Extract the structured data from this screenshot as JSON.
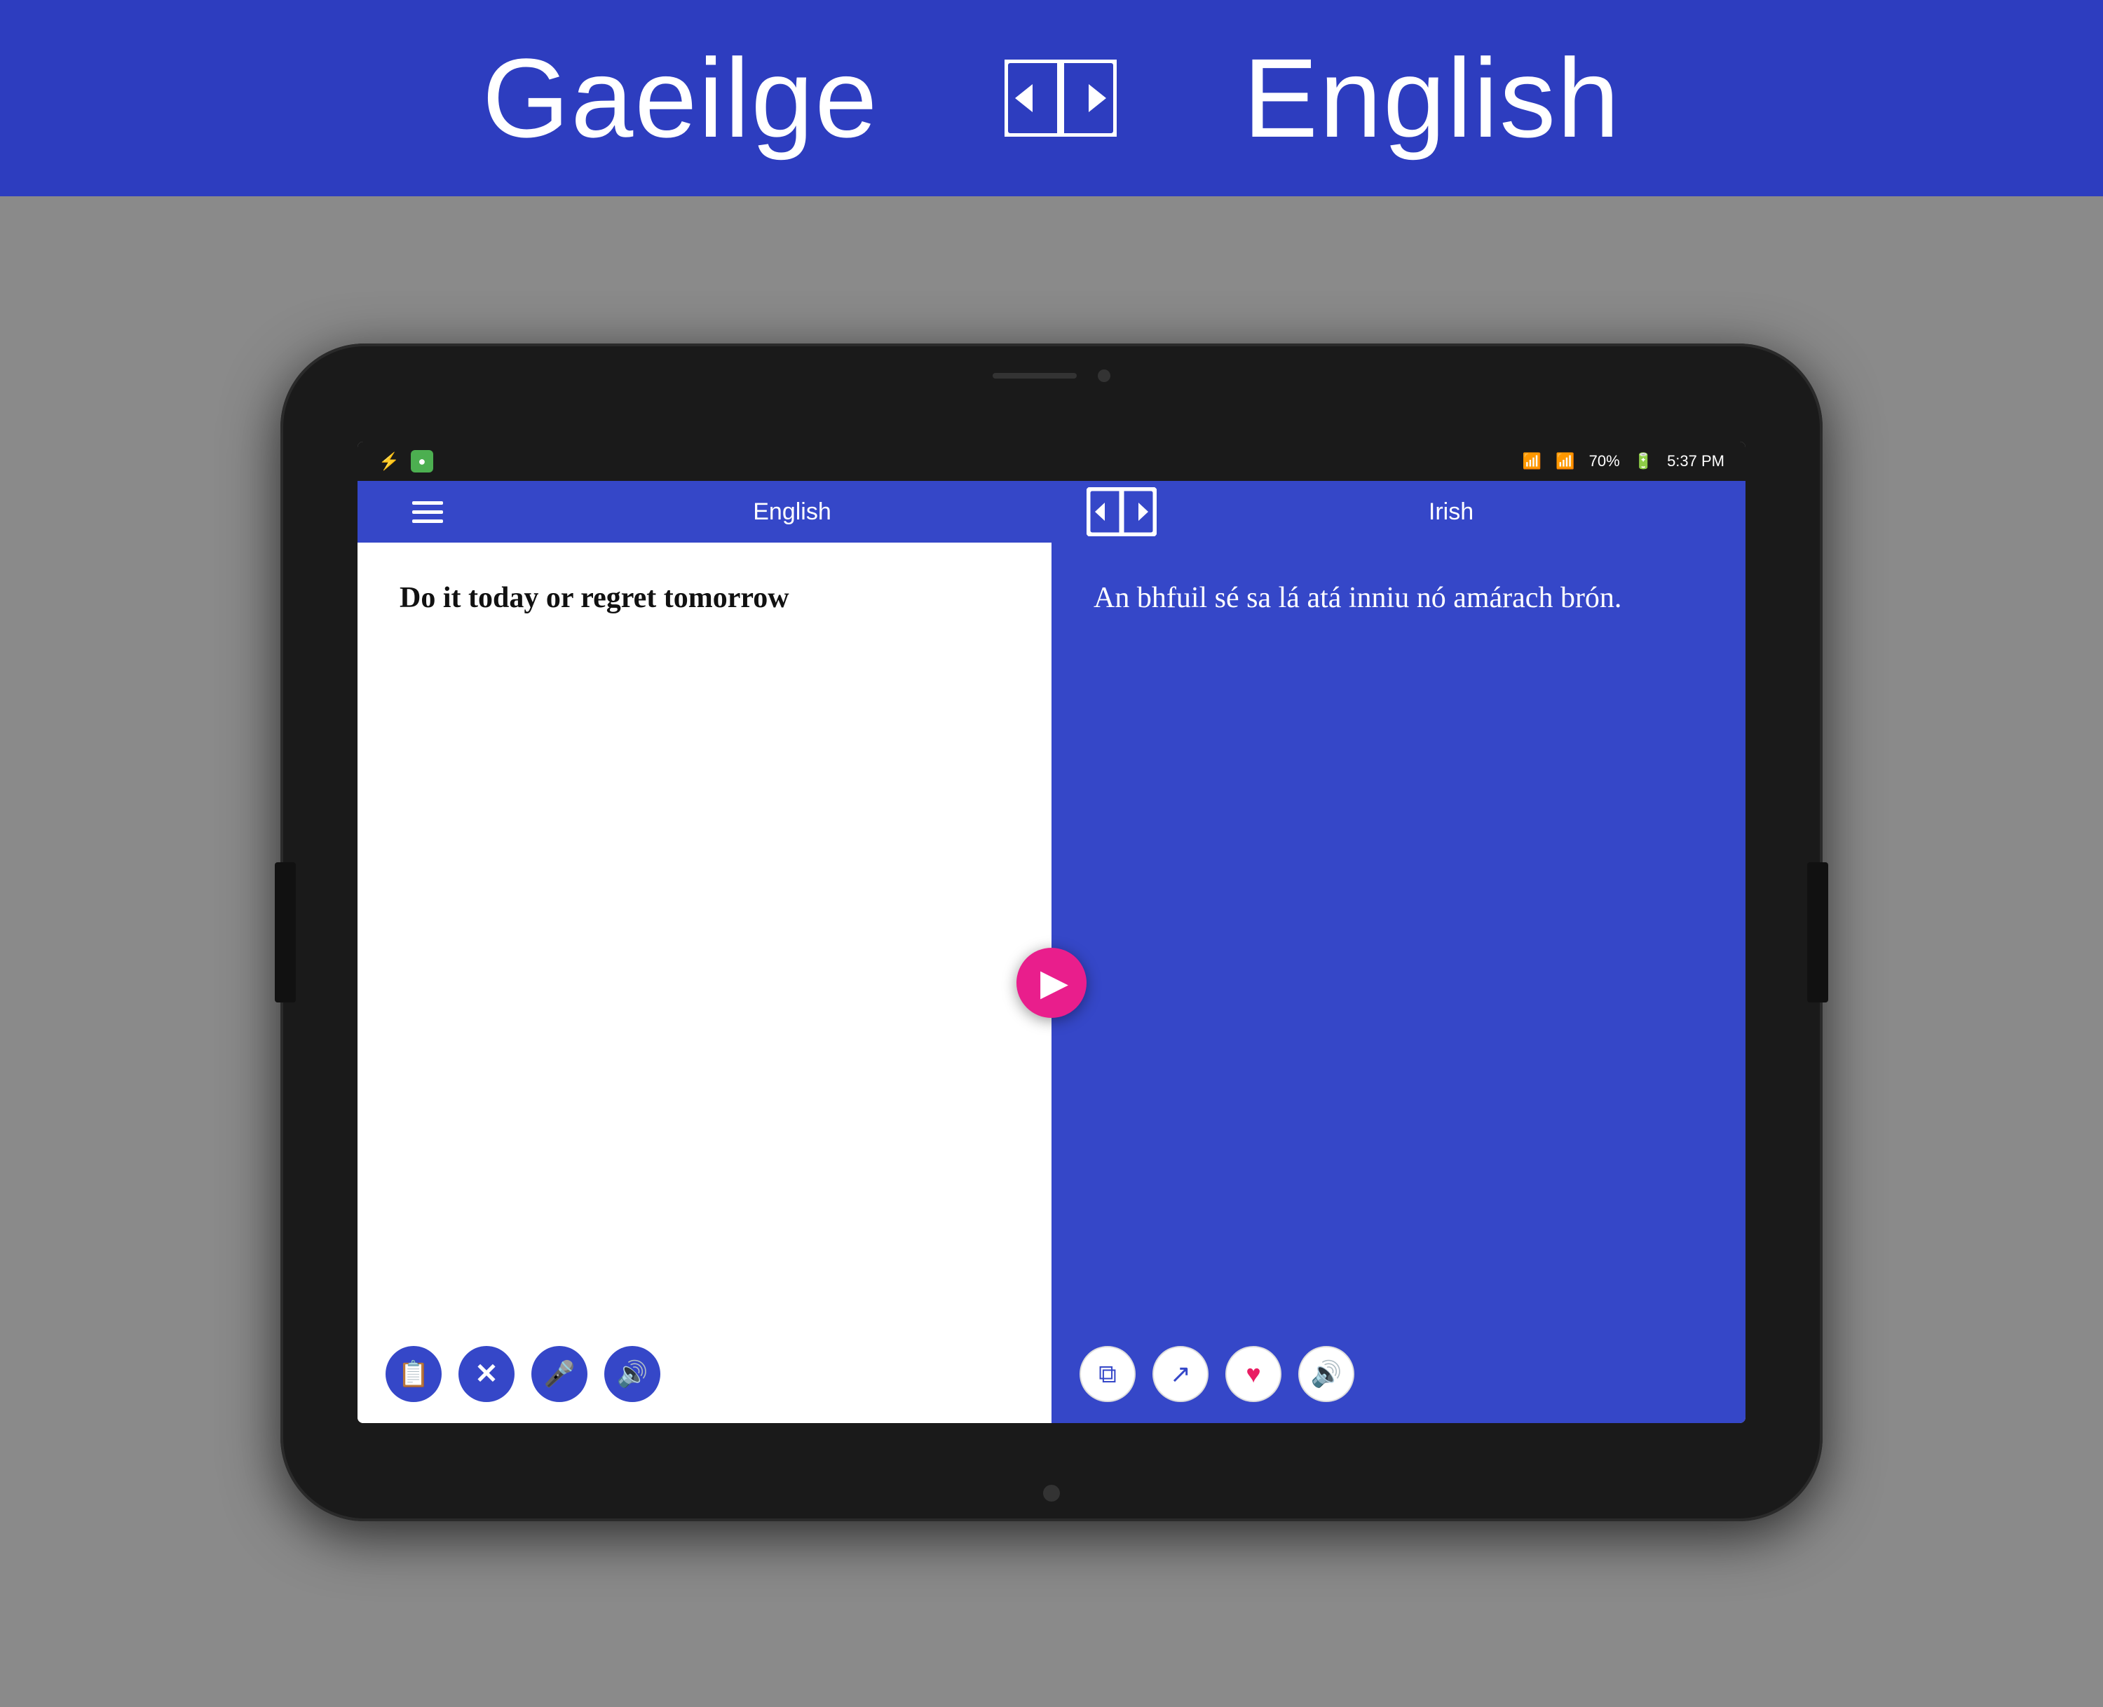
{
  "banner": {
    "source_lang": "Gaeilge",
    "target_lang": "English"
  },
  "status_bar": {
    "time": "5:37 PM",
    "battery_pct": "70%",
    "icons": {
      "usb": "⚡",
      "wifi": "WiFi",
      "signal": "Signal"
    }
  },
  "app_header": {
    "source_lang": "English",
    "target_lang": "Irish",
    "menu_label": "Menu"
  },
  "input_panel": {
    "text": "Do it today or regret tomorrow",
    "actions": {
      "clipboard": "Clipboard",
      "clear": "Clear",
      "mic": "Microphone",
      "speaker": "Speaker"
    }
  },
  "output_panel": {
    "text": "An bhfuil sé sa lá atá inniu nó amárach brón.",
    "actions": {
      "copy": "Copy",
      "share": "Share",
      "favorite": "Favorite",
      "speaker": "Speaker"
    }
  },
  "translate_button": {
    "label": "Translate"
  }
}
